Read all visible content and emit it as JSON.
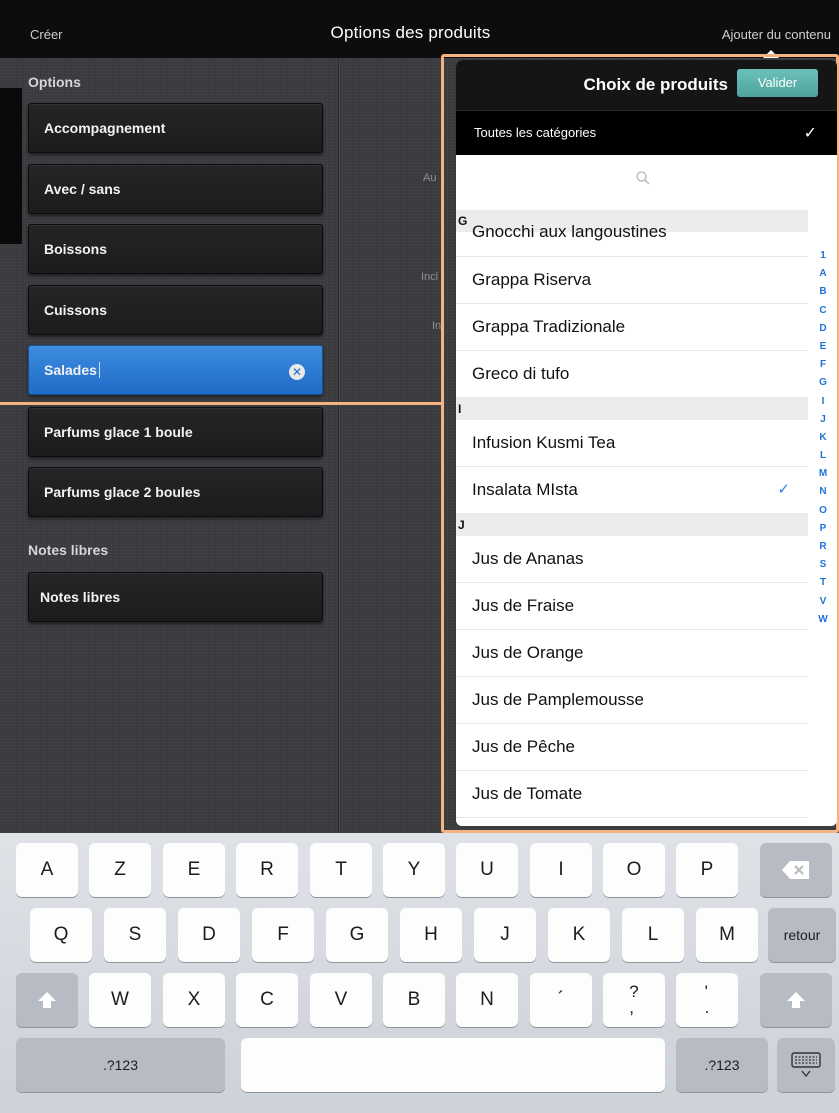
{
  "topbar": {
    "left_label": "Créer",
    "title": "Options des produits",
    "right_label": "Ajouter du contenu"
  },
  "left_panel": {
    "options_header": "Options",
    "options": [
      {
        "label": "Accompagnement",
        "active": false
      },
      {
        "label": "Avec / sans",
        "active": false
      },
      {
        "label": "Boissons",
        "active": false
      },
      {
        "label": "Cuissons",
        "active": false
      },
      {
        "label": "Salades",
        "active": true
      },
      {
        "label": "Parfums glace 1 boule",
        "active": false
      },
      {
        "label": "Parfums glace 2 boules",
        "active": false
      }
    ],
    "notes_header": "Notes libres",
    "notes_button": "Notes libres",
    "hidden_labels": [
      "Au",
      "Incl",
      "In"
    ]
  },
  "popover": {
    "title": "Choix de produits",
    "validate_label": "Valider",
    "category_label": "Toutes les catégories",
    "search_placeholder": "",
    "sections": [
      {
        "letter": "G",
        "items": [
          {
            "label": "Gnocchi aux langoustines",
            "checked": false
          },
          {
            "label": "Grappa Riserva",
            "checked": false
          },
          {
            "label": "Grappa Tradizionale",
            "checked": false
          },
          {
            "label": "Greco di tufo",
            "checked": false
          }
        ]
      },
      {
        "letter": "I",
        "items": [
          {
            "label": "Infusion Kusmi Tea",
            "checked": false
          },
          {
            "label": "Insalata MIsta",
            "checked": true
          }
        ]
      },
      {
        "letter": "J",
        "items": [
          {
            "label": "Jus de Ananas",
            "checked": false
          },
          {
            "label": "Jus de Fraise",
            "checked": false
          },
          {
            "label": "Jus de Orange",
            "checked": false
          },
          {
            "label": "Jus de Pamplemousse",
            "checked": false
          },
          {
            "label": "Jus de Pêche",
            "checked": false
          },
          {
            "label": "Jus de Tomate",
            "checked": false
          }
        ]
      }
    ],
    "index_letters": [
      "1",
      "A",
      "B",
      "C",
      "D",
      "E",
      "F",
      "G",
      "I",
      "J",
      "K",
      "L",
      "M",
      "N",
      "O",
      "P",
      "R",
      "S",
      "T",
      "V",
      "W"
    ]
  },
  "keyboard": {
    "row1": [
      "A",
      "Z",
      "E",
      "R",
      "T",
      "Y",
      "U",
      "I",
      "O",
      "P"
    ],
    "row2": [
      "Q",
      "S",
      "D",
      "F",
      "G",
      "H",
      "J",
      "K",
      "L",
      "M"
    ],
    "return_label": "retour",
    "row3": [
      "W",
      "X",
      "C",
      "V",
      "B",
      "N"
    ],
    "row3_punct": [
      "´",
      "?\n,",
      "'\n."
    ],
    "num_label": ".?123"
  },
  "colors": {
    "accent_blue": "#2f7fe6",
    "validate_teal": "#5bb3ad",
    "highlight_orange": "#f6b37f"
  }
}
